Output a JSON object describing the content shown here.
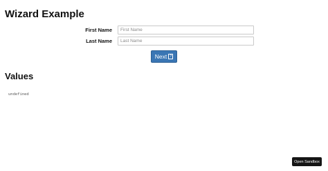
{
  "page_title": "Wizard Example",
  "form": {
    "first_name": {
      "label": "First Name",
      "value": "",
      "placeholder": "First Name"
    },
    "last_name": {
      "label": "Last Name",
      "value": "",
      "placeholder": "Last Name"
    },
    "next_button": {
      "label": "Next",
      "icon": "question-box-icon",
      "icon_glyph": "?"
    }
  },
  "values": {
    "heading": "Values",
    "output": "undefined"
  },
  "sandbox_button": {
    "label": "Open Sandbox"
  },
  "colors": {
    "primary_button": "#3a76b4",
    "sandbox_button": "#151515"
  }
}
